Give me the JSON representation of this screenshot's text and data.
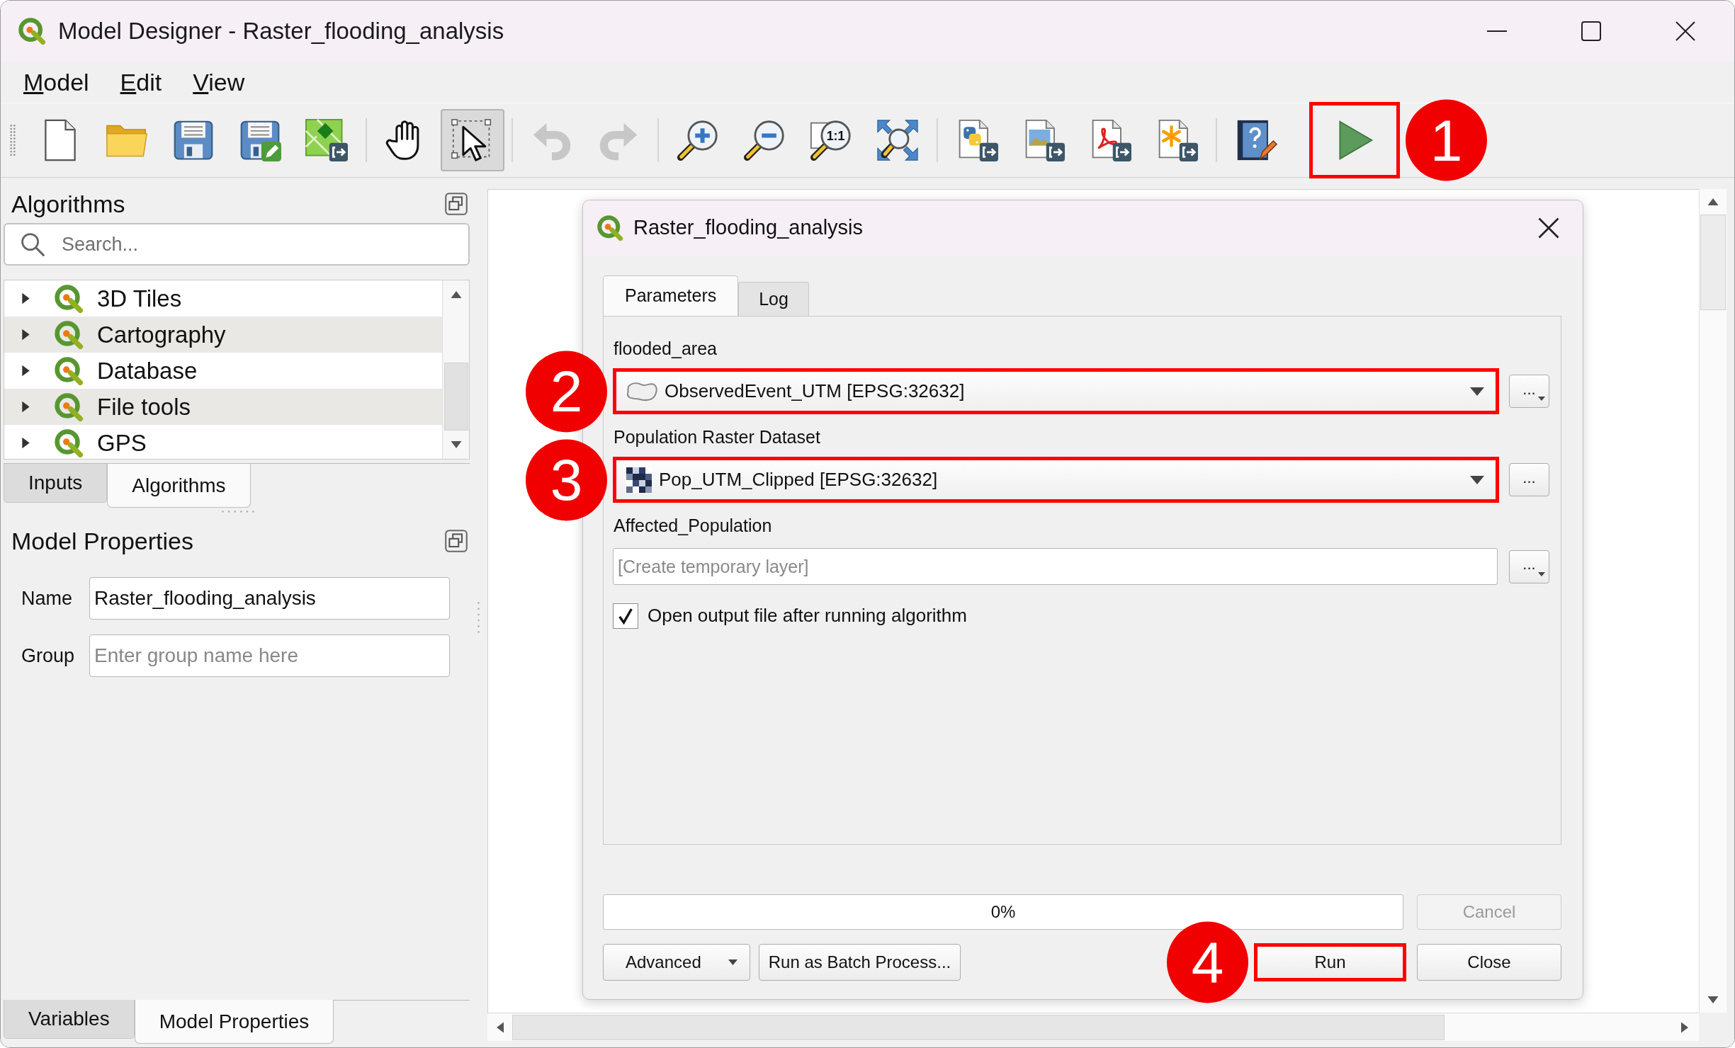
{
  "window": {
    "title": "Model Designer - Raster_flooding_analysis"
  },
  "menu": [
    {
      "label": "Model"
    },
    {
      "label": "Edit"
    },
    {
      "label": "View"
    }
  ],
  "toolbar": {
    "groups": [
      [
        {
          "pressed": false,
          "disabled": false,
          "highlighted": false
        },
        {
          "pressed": false,
          "disabled": false,
          "highlighted": false
        },
        {
          "pressed": false,
          "disabled": false,
          "highlighted": false
        },
        {
          "pressed": false,
          "disabled": false,
          "highlighted": false
        },
        {
          "pressed": false,
          "disabled": false,
          "highlighted": false
        }
      ],
      [
        {
          "pressed": false,
          "disabled": false,
          "highlighted": false
        },
        {
          "pressed": true,
          "disabled": false,
          "highlighted": false
        }
      ],
      [
        {
          "pressed": false,
          "disabled": true,
          "highlighted": false
        },
        {
          "pressed": false,
          "disabled": true,
          "highlighted": false
        }
      ],
      [
        {
          "pressed": false,
          "disabled": false,
          "highlighted": false
        },
        {
          "pressed": false,
          "disabled": false,
          "highlighted": false
        },
        {
          "text": "1:1",
          "pressed": false,
          "disabled": false,
          "highlighted": false
        },
        {
          "pressed": false,
          "disabled": false,
          "highlighted": false
        }
      ],
      [
        {
          "pressed": false,
          "disabled": false,
          "highlighted": false
        },
        {
          "pressed": false,
          "disabled": false,
          "highlighted": false
        },
        {
          "pressed": false,
          "disabled": false,
          "highlighted": false
        },
        {
          "pressed": false,
          "disabled": false,
          "highlighted": false
        }
      ],
      [
        {
          "pressed": false,
          "disabled": false,
          "highlighted": false
        },
        {
          "pressed": false,
          "disabled": false,
          "highlighted": true,
          "callout": "1"
        }
      ]
    ]
  },
  "left_panel": {
    "algorithms": {
      "title": "Algorithms",
      "search": {
        "placeholder": "Search..."
      },
      "tree": [
        {
          "label": "3D Tiles",
          "expanded": false
        },
        {
          "label": "Cartography",
          "expanded": false
        },
        {
          "label": "Database",
          "expanded": false
        },
        {
          "label": "File tools",
          "expanded": false
        },
        {
          "label": "GPS",
          "expanded": false
        }
      ]
    },
    "upper_tabs": [
      {
        "label": "Inputs",
        "selected": false
      },
      {
        "label": "Algorithms",
        "selected": true
      }
    ],
    "properties": {
      "title": "Model Properties",
      "fields": [
        {
          "label": "Name",
          "value": "Raster_flooding_analysis"
        },
        {
          "label": "Group",
          "placeholder": "Enter group name here"
        }
      ]
    },
    "lower_tabs": [
      {
        "label": "Variables",
        "selected": false
      },
      {
        "label": "Model Properties",
        "selected": true
      }
    ]
  },
  "dialog": {
    "title": "Raster_flooding_analysis",
    "tabs": [
      {
        "label": "Parameters",
        "selected": true
      },
      {
        "label": "Log",
        "selected": false
      }
    ],
    "parameters": [
      {
        "kind": "layer",
        "label": "flooded_area",
        "value": "ObservedEvent_UTM [EPSG:32632]",
        "browse": "...",
        "browse_menu": true,
        "highlighted": true,
        "callout": "2"
      },
      {
        "kind": "layer",
        "label": "Population Raster Dataset",
        "value": "Pop_UTM_Clipped [EPSG:32632]",
        "browse": "...",
        "browse_menu": false,
        "highlighted": true,
        "callout": "3"
      },
      {
        "kind": "output",
        "label": "Affected_Population",
        "placeholder": "[Create temporary layer]",
        "browse": "...",
        "browse_menu": true,
        "highlighted": false
      }
    ],
    "open_output": {
      "label": "Open output file after running algorithm",
      "checked": true
    },
    "progress": {
      "level": 0,
      "text": "0%"
    },
    "cancel": {
      "label": "Cancel",
      "disabled": true
    },
    "left_buttons": [
      {
        "label": "Advanced",
        "menu": true
      },
      {
        "label": "Run as Batch Process...",
        "menu": false
      }
    ],
    "right_buttons": [
      {
        "label": "Run",
        "highlighted": true,
        "callout": "4"
      },
      {
        "label": "Close",
        "highlighted": false
      }
    ]
  }
}
